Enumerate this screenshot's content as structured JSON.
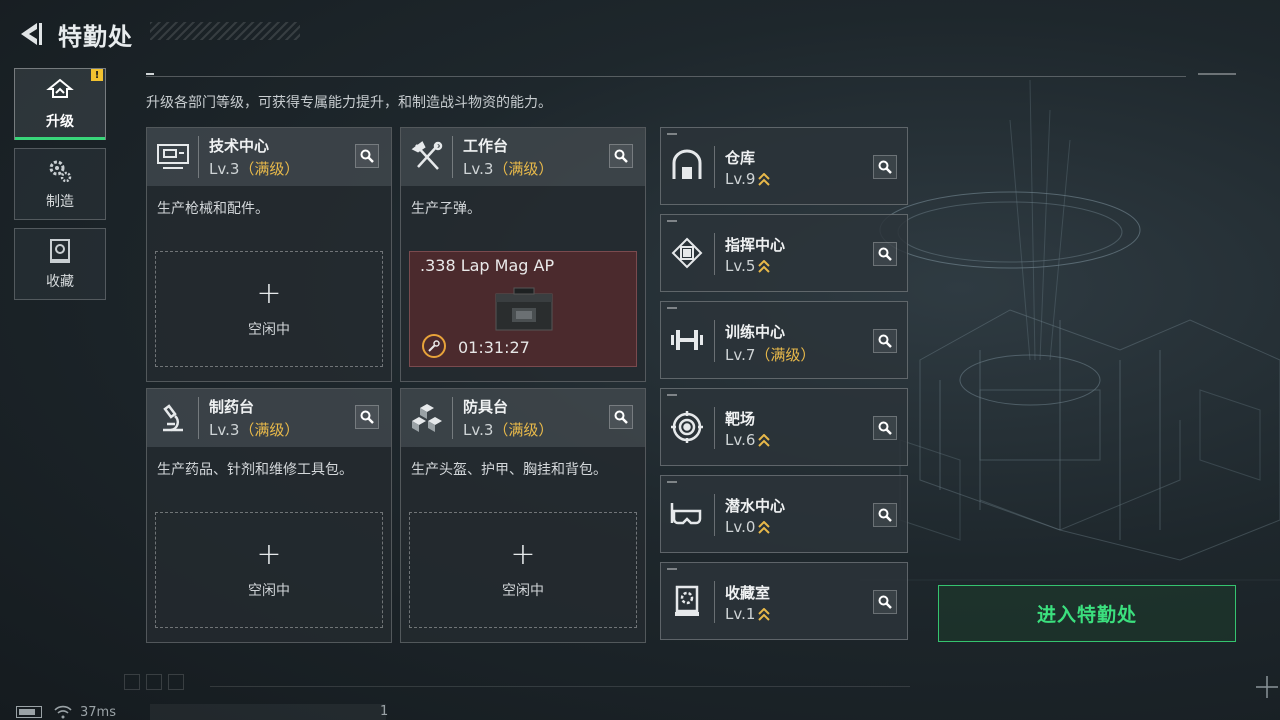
{
  "header": {
    "title": "特勤处"
  },
  "description": "升级各部门等级，可获得专属能力提升，和制造战斗物资的能力。",
  "nav": {
    "items": [
      {
        "label": "升级",
        "icon": "upgrade-icon",
        "active": true,
        "badge": "!"
      },
      {
        "label": "制造",
        "icon": "gears-icon"
      },
      {
        "label": "收藏",
        "icon": "collection-icon"
      }
    ]
  },
  "cards": [
    {
      "name": "技术中心",
      "level": "Lv.3",
      "max_tag": "（满级）",
      "icon": "tech-center-icon",
      "desc": "生产枪械和配件。",
      "slot": {
        "status": "idle",
        "plus": "+",
        "label": "空闲中"
      }
    },
    {
      "name": "工作台",
      "level": "Lv.3",
      "max_tag": "（满级）",
      "icon": "workbench-tools-icon",
      "desc": "生产子弹。",
      "slot": {
        "status": "crafting",
        "item": ".338 Lap Mag AP",
        "time": "01:31:27"
      }
    },
    {
      "name": "制药台",
      "level": "Lv.3",
      "max_tag": "（满级）",
      "icon": "microscope-icon",
      "desc": "生产药品、针剂和维修工具包。",
      "slot": {
        "status": "idle",
        "plus": "+",
        "label": "空闲中"
      }
    },
    {
      "name": "防具台",
      "level": "Lv.3",
      "max_tag": "（满级）",
      "icon": "armor-blocks-icon",
      "desc": "生产头盔、护甲、胸挂和背包。",
      "slot": {
        "status": "idle",
        "plus": "+",
        "label": "空闲中"
      }
    }
  ],
  "facilities": [
    {
      "name": "仓库",
      "level": "Lv.9",
      "max_tag": "",
      "upgradable": true,
      "icon": "warehouse-icon"
    },
    {
      "name": "指挥中心",
      "level": "Lv.5",
      "max_tag": "",
      "upgradable": true,
      "icon": "chip-icon"
    },
    {
      "name": "训练中心",
      "level": "Lv.7",
      "max_tag": "（满级）",
      "upgradable": false,
      "icon": "dumbbell-icon"
    },
    {
      "name": "靶场",
      "level": "Lv.6",
      "max_tag": "",
      "upgradable": true,
      "icon": "target-icon"
    },
    {
      "name": "潜水中心",
      "level": "Lv.0",
      "max_tag": "",
      "upgradable": true,
      "icon": "diving-goggles-icon"
    },
    {
      "name": "收藏室",
      "level": "Lv.1",
      "max_tag": "",
      "upgradable": true,
      "icon": "display-case-icon"
    }
  ],
  "enter_button": {
    "label": "进入特勤处"
  },
  "status": {
    "ping": "37ms",
    "number": "1"
  },
  "colors": {
    "accent_green": "#3be07e",
    "max_gold": "#e8b94a",
    "alert_yellow": "#f2c230",
    "crafting_bg": "#4b2a2d"
  }
}
